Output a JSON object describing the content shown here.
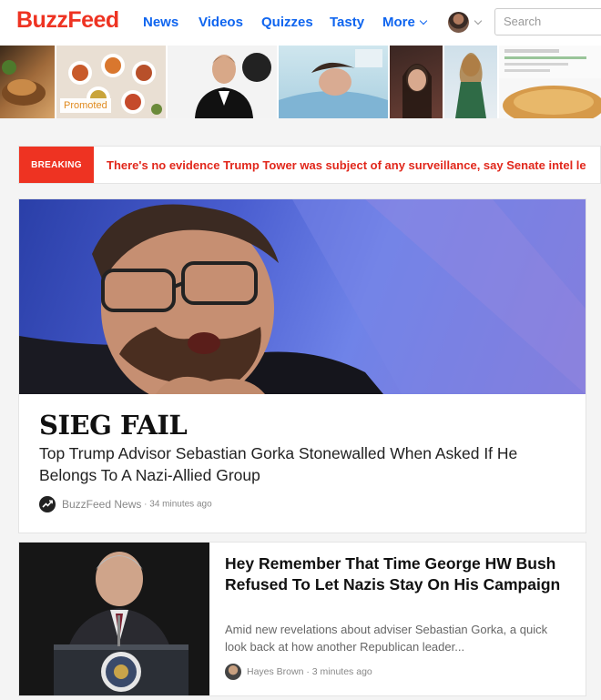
{
  "header": {
    "logo": "BuzzFeed",
    "nav": [
      {
        "label": "News"
      },
      {
        "label": "Videos"
      },
      {
        "label": "Quizzes"
      },
      {
        "label": "Tasty"
      },
      {
        "label": "More"
      }
    ],
    "search_placeholder": "Search"
  },
  "thumbnails": {
    "promoted_label": "Promoted"
  },
  "breaking": {
    "tag": "BREAKING",
    "text": "There's no evidence Trump Tower was subject of any surveillance, say Senate intel le"
  },
  "main_story": {
    "kicker": "SIEG FAIL",
    "headline": "Top Trump Advisor Sebastian Gorka Stonewalled When Asked If He Belongs To A Nazi-Allied Group",
    "source": "BuzzFeed News",
    "time": " · 34 minutes ago"
  },
  "second_story": {
    "title": "Hey Remember That Time George HW Bush Refused To Let Nazis Stay On His Campaign",
    "description": "Amid new revelations about adviser Sebastian Gorka, a quick look back at how another Republican leader...",
    "author": "Hayes Brown",
    "time": " · 3 minutes ago"
  },
  "colors": {
    "brand_red": "#ee3322",
    "nav_blue": "#0f65ef",
    "promoted_orange": "#e08a1e"
  }
}
